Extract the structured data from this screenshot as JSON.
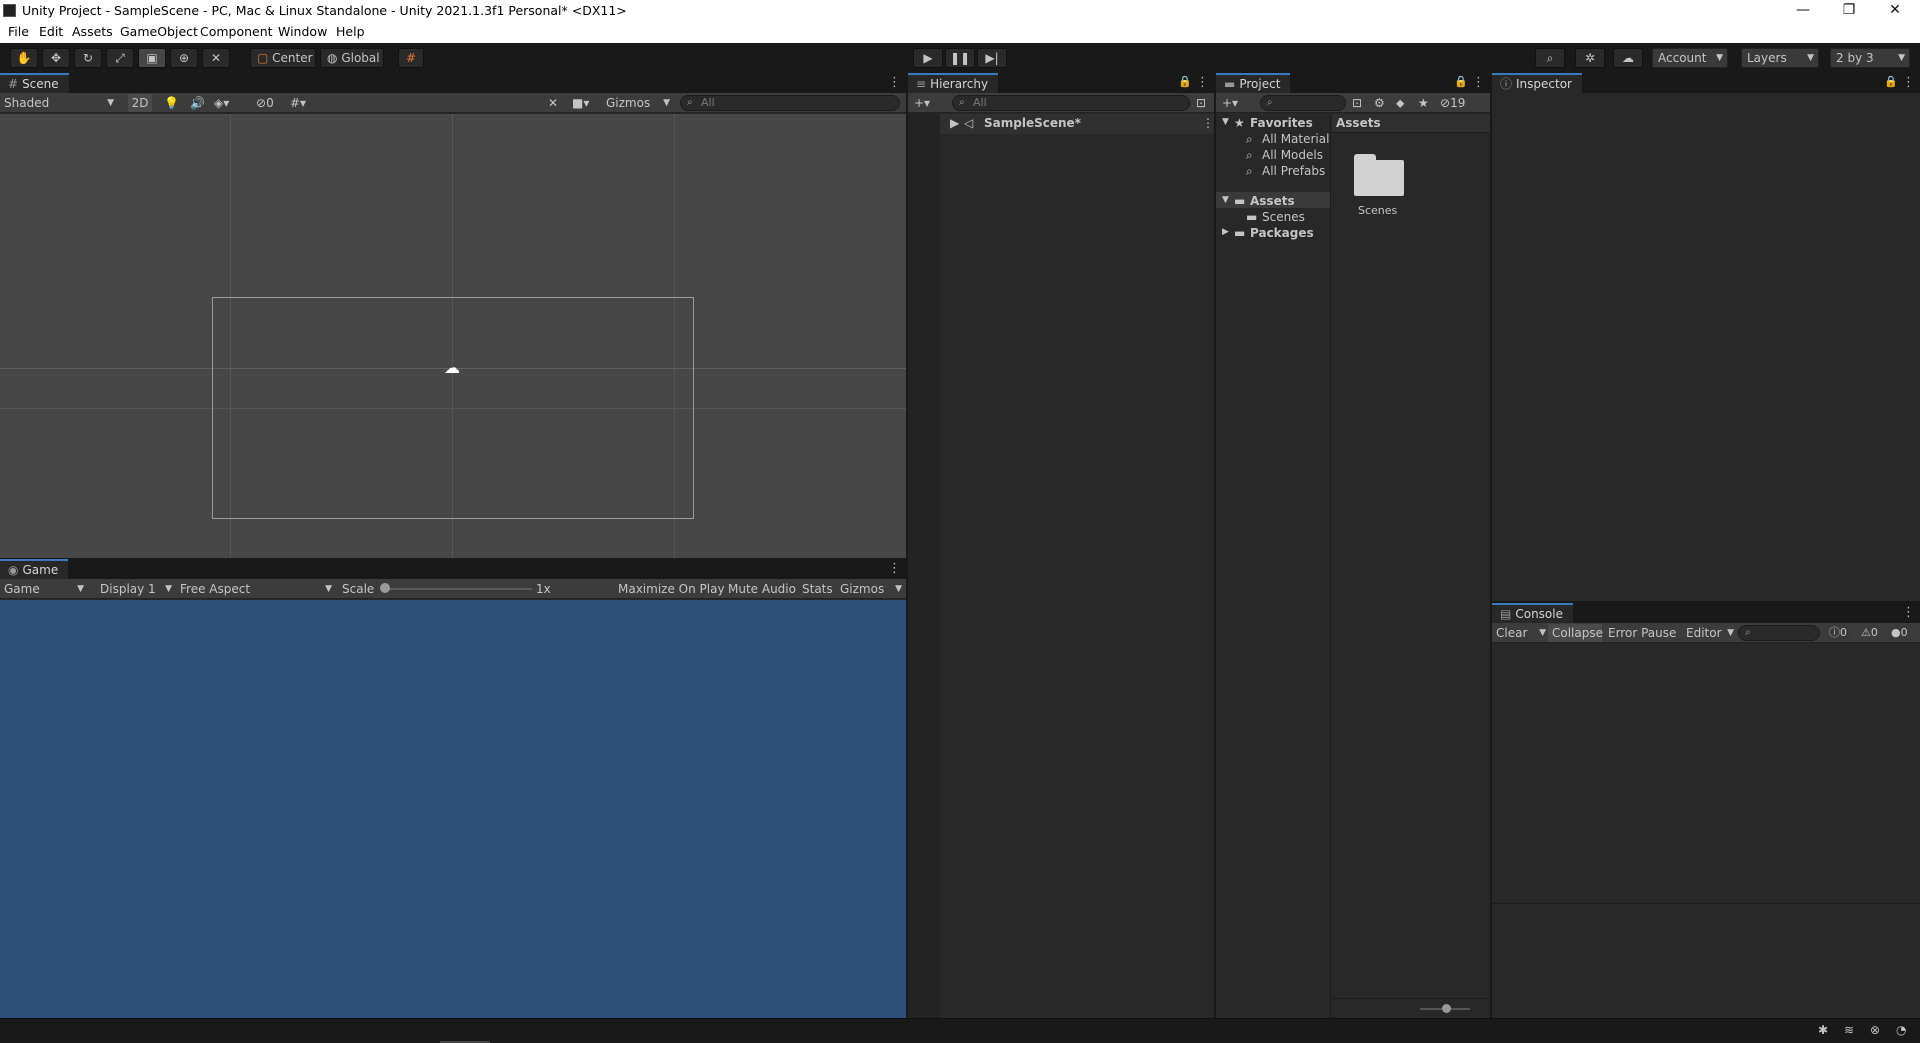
{
  "window": {
    "title": "Unity Project - SampleScene - PC, Mac & Linux Standalone - Unity 2021.1.3f1 Personal* <DX11>",
    "minimize": "—",
    "maximize": "❐",
    "close": "✕"
  },
  "menu": [
    "File",
    "Edit",
    "Assets",
    "GameObject",
    "Component",
    "Window",
    "Help"
  ],
  "toolbar": {
    "pivot_label": "Center",
    "space_label": "Global",
    "account_label": "Account",
    "layers_label": "Layers",
    "layout_label": "2 by 3"
  },
  "scene": {
    "tab": "Scene",
    "draw_mode": "Shaded",
    "toggle_2d": "2D",
    "hidden_count": "0",
    "gizmos": "Gizmos",
    "search_placeholder": "All"
  },
  "game": {
    "tab": "Game",
    "view": "Game",
    "display": "Display 1",
    "aspect": "Free Aspect",
    "scale_label": "Scale",
    "scale_value": "1x",
    "maximize": "Maximize On Play",
    "mute": "Mute Audio",
    "stats": "Stats",
    "gizmos": "Gizmos",
    "background": "#2f4f7b"
  },
  "hierarchy": {
    "tab": "Hierarchy",
    "search_placeholder": "All",
    "root": "SampleScene*"
  },
  "project": {
    "tab": "Project",
    "hidden_count": "19",
    "favorites": "Favorites",
    "fav_items": [
      "All Materials",
      "All Models",
      "All Prefabs"
    ],
    "assets": "Assets",
    "scenes": "Scenes",
    "packages": "Packages",
    "grid_header": "Assets",
    "folder_label": "Scenes"
  },
  "inspector": {
    "tab": "Inspector"
  },
  "console": {
    "tab": "Console",
    "clear": "Clear",
    "collapse": "Collapse",
    "error_pause": "Error Pause",
    "editor": "Editor",
    "log_count": "0",
    "warn_count": "0",
    "error_count": "0"
  },
  "colors": {
    "accent": "#3a79bb",
    "panel": "#282828",
    "scene_bg": "#474747"
  }
}
